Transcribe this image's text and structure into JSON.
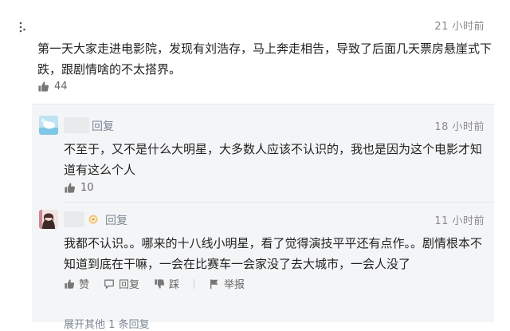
{
  "main_comment": {
    "time": "21 小时前",
    "text": "第一天大家走进电影院，发现有刘浩存，马上奔走相告，导致了后面几天票房悬崖式下跌，跟剧情啥的不太搭界。",
    "like_count": "44"
  },
  "replies": [
    {
      "reply_label": "回复",
      "time": "18 小时前",
      "text": "不至于，又不是什么大明星，大多数人应该不认识的，我也是因为这个电影才知道有这么个人",
      "like_count": "10"
    },
    {
      "reply_label": "回复",
      "time": "11 小时前",
      "text": "我都不认识。。哪来的十八线小明星，看了觉得演技平平还有点作。。剧情根本不知道到底在干嘛，一会在比赛车一会家没了去大城市，一会人没了",
      "actions": {
        "like_label": "赞",
        "reply_label": "回复",
        "dislike_label": "踩",
        "report_label": "举报"
      }
    }
  ],
  "expand_text": "展开其他 1 条回复"
}
